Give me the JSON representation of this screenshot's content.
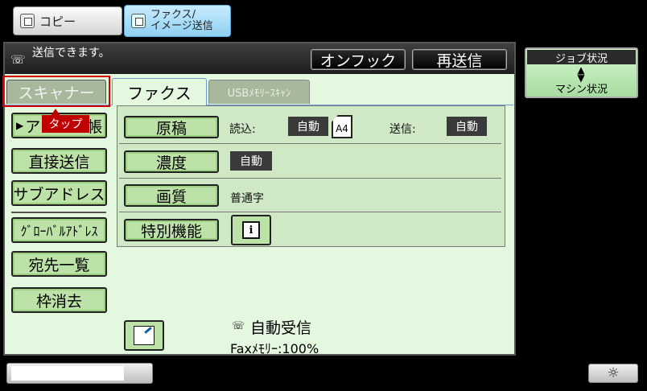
{
  "mode_tabs": {
    "copy": "コピー",
    "fax_line1": "ファクス/",
    "fax_line2": "イメージ送信"
  },
  "status": {
    "message": "送信できます。",
    "onhook_label": "オンフック",
    "resend_label": "再送信"
  },
  "tabs": {
    "scanner": "スキャナー",
    "fax": "ファクス",
    "usb": "USBﾒﾓﾘｰｽｷｬﾝ"
  },
  "tap_label": "タップ",
  "sidebar": {
    "address_book_prefix": "ア",
    "address_book_suffix": "帳",
    "direct_send": "直接送信",
    "sub_address": "サブアドレス",
    "global_address": "ｸﾞﾛｰﾊﾞﾙｱﾄﾞﾚｽ",
    "destination_list": "宛先一覧",
    "frame_erase": "枠消去"
  },
  "settings": {
    "original_label": "原稿",
    "read_label": "読込:",
    "read_value": "自動",
    "paper_size": "A4",
    "send_label": "送信:",
    "send_value": "自動",
    "density_label": "濃度",
    "density_value": "自動",
    "quality_label": "画質",
    "quality_value": "普通字",
    "special_label": "特別機能",
    "info_icon_glyph": "i"
  },
  "footer": {
    "auto_receive": "自動受信",
    "fax_memory": "Faxﾒﾓﾘｰ:100%"
  },
  "right_panel": {
    "job_status": "ジョブ状況",
    "machine_status": "マシン状況"
  },
  "colors": {
    "panel_bg": "#e4f7df",
    "button_green": "#bde2a8",
    "highlight_red": "#d40000",
    "fax_tab_accent": "#8fd0f2"
  },
  "icons": [
    "copy-icon",
    "fax-image-send-icon",
    "phone-icon",
    "info-icon",
    "contacts-edit-icon",
    "receive-phone-icon",
    "up-down-arrow-icon",
    "brightness-icon"
  ]
}
